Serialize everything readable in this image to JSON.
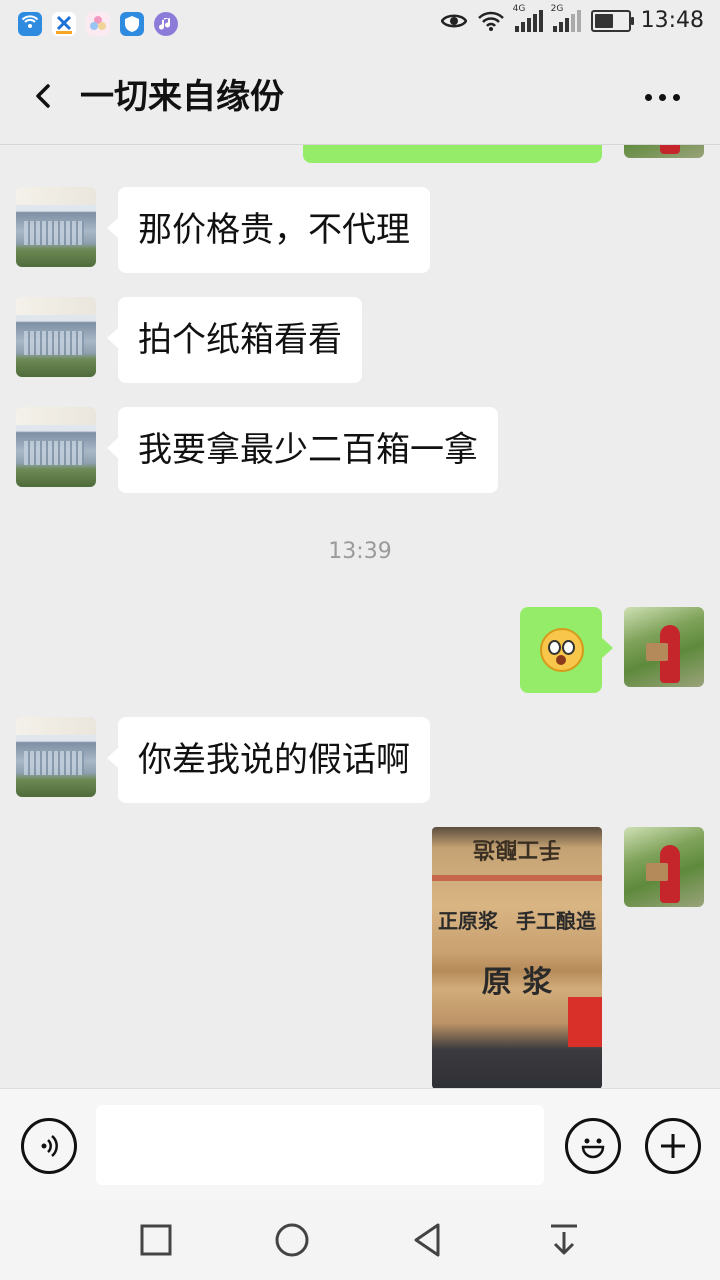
{
  "status_bar": {
    "time": "13:48",
    "signal1_label": "4G",
    "signal2_label": "2G",
    "battery_level": 0.55,
    "left_icons": [
      "wifi-hotspot-icon",
      "app-icon-x",
      "app-icon-flower",
      "shield-icon",
      "music-icon"
    ]
  },
  "header": {
    "title": "一切来自缘份"
  },
  "messages": [
    {
      "side": "left",
      "type": "text",
      "text": "那价格贵，不代理"
    },
    {
      "side": "left",
      "type": "text",
      "text": "拍个纸箱看看"
    },
    {
      "side": "left",
      "type": "text",
      "text": "我要拿最少二百箱一拿"
    },
    {
      "type": "time",
      "text": "13:39"
    },
    {
      "side": "right",
      "type": "emoji",
      "icon": "surprised-face-emoji-icon"
    },
    {
      "side": "left",
      "type": "text",
      "text": "你差我说的假话啊"
    },
    {
      "side": "right",
      "type": "image",
      "photo_text_1": "手工酿造",
      "photo_text_2": "正原浆",
      "photo_text_3": "原 浆"
    }
  ],
  "colors": {
    "sent_bubble": "#95ec69",
    "received_bubble": "#ffffff",
    "background": "#ededed"
  },
  "input": {
    "value": ""
  }
}
